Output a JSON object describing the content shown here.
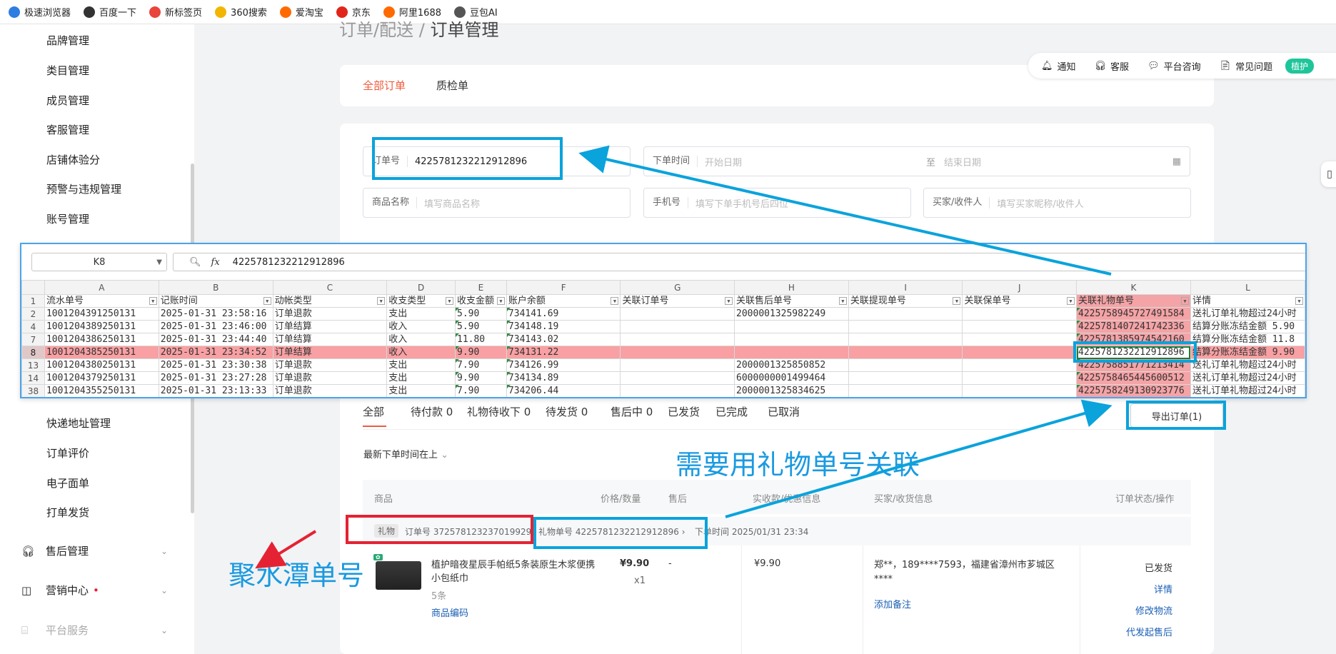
{
  "bookmarks": [
    {
      "label": "极速浏览器",
      "color": "#2f7de1"
    },
    {
      "label": "百度一下",
      "color": "#333333"
    },
    {
      "label": "新标签页",
      "color": "#e8453c"
    },
    {
      "label": "360搜索",
      "color": "#f2b600"
    },
    {
      "label": "爱淘宝",
      "color": "#ff6a00"
    },
    {
      "label": "京东",
      "color": "#e1251b"
    },
    {
      "label": "阿里1688",
      "color": "#ff6a00"
    },
    {
      "label": "豆包AI",
      "color": "#555555"
    }
  ],
  "sidebar": {
    "items": [
      "品牌管理",
      "类目管理",
      "成员管理",
      "客服管理",
      "店铺体验分",
      "预警与违规管理",
      "账号管理",
      "快递地址管理",
      "订单评价",
      "电子面单",
      "打单发货"
    ],
    "groups": [
      "售后管理",
      "营销中心",
      "平台服务"
    ]
  },
  "breadcrumb": {
    "parent": "订单/配送 /",
    "current": "订单管理"
  },
  "tabs": {
    "all": "全部订单",
    "inspect": "质检单"
  },
  "helpbar": {
    "notice": "通知",
    "service": "客服",
    "consult": "平台咨询",
    "faq": "常见问题",
    "pill": "植护"
  },
  "filters": {
    "order_no_label": "订单号",
    "order_no_value": "4225781232212912896",
    "time_label": "下单时间",
    "start_ph": "开始日期",
    "to": "至",
    "end_ph": "结束日期",
    "goods_label": "商品名称",
    "goods_ph": "填写商品名称",
    "phone_label": "手机号",
    "phone_ph": "填写下单手机号后四位",
    "buyer_label": "买家/收件人",
    "buyer_ph": "填写买家昵称/收件人"
  },
  "sheet": {
    "cell_ref": "K8",
    "formula": "4225781232212912896",
    "columns": [
      "A",
      "B",
      "C",
      "D",
      "E",
      "F",
      "G",
      "H",
      "I",
      "J",
      "K",
      "L"
    ],
    "headers": [
      "流水单号",
      "记账时间",
      "动帐类型",
      "收支类型",
      "收支金额",
      "账户余额",
      "关联订单号",
      "关联售后单号",
      "关联提现单号",
      "关联保单号",
      "关联礼物单号",
      "详情"
    ],
    "rows": [
      {
        "n": "2",
        "cells": [
          "1001204391250131",
          "2025-01-31 23:58:16",
          "订单退款",
          "支出",
          "5.90",
          "734141.69",
          "",
          "2000001325982249",
          "",
          "",
          "4225758945727491584",
          "送礼订单礼物超过24小时"
        ]
      },
      {
        "n": "4",
        "cells": [
          "1001204389250131",
          "2025-01-31 23:46:00",
          "订单结算",
          "收入",
          "5.90",
          "734148.19",
          "",
          "",
          "",
          "",
          "4225781407241742336",
          "结算分账冻结金额 5.90"
        ]
      },
      {
        "n": "7",
        "cells": [
          "1001204386250131",
          "2025-01-31 23:44:40",
          "订单结算",
          "收入",
          "11.80",
          "734143.02",
          "",
          "",
          "",
          "",
          "4225781385974542160",
          "结算分账冻结金额 11.8"
        ]
      },
      {
        "n": "8",
        "cells": [
          "1001204385250131",
          "2025-01-31 23:34:52",
          "订单结算",
          "收入",
          "9.90",
          "734131.22",
          "",
          "",
          "",
          "",
          "4225781232212912896",
          "结算分账冻结金额 9.90"
        ]
      },
      {
        "n": "13",
        "cells": [
          "1001204380250131",
          "2025-01-31 23:30:38",
          "订单退款",
          "支出",
          "7.90",
          "734126.99",
          "",
          "2000001325850852",
          "",
          "",
          "4225758851771213414",
          "送礼订单礼物超过24小时"
        ]
      },
      {
        "n": "14",
        "cells": [
          "1001204379250131",
          "2025-01-31 23:27:28",
          "订单退款",
          "支出",
          "9.90",
          "734134.89",
          "",
          "6000000001499464",
          "",
          "",
          "4225758465445600512",
          "送礼订单礼物超过24小时"
        ]
      },
      {
        "n": "38",
        "cells": [
          "1001204355250131",
          "2025-01-31 23:13:33",
          "订单退款",
          "支出",
          "7.90",
          "734206.44",
          "",
          "2000001325834625",
          "",
          "",
          "4225758249130923776",
          "送礼订单礼物超过24小时"
        ]
      }
    ]
  },
  "status_tabs": [
    "全部",
    "待付款 0",
    "礼物待收下 0",
    "待发货 0",
    "售后中 0",
    "已发货",
    "已完成",
    "已取消"
  ],
  "export_label": "导出订单(1)",
  "sort_label": "最新下单时间在上",
  "thead": [
    "商品",
    "价格/数量",
    "售后",
    "实收款/优惠信息",
    "买家/收货信息",
    "订单状态/操作"
  ],
  "order": {
    "gift_badge": "礼物",
    "order_no": "订单号 3725781232370199296",
    "gift_no": "礼物单号 4225781232212912896",
    "time": "下单时间 2025/01/31 23:34",
    "title": "植护暗夜星辰手帕纸5条装原生木浆便携小包纸巾",
    "spec": "5条",
    "code_link": "商品编码",
    "price": "¥9.90",
    "qty": "x1",
    "after": "-",
    "paid": "¥9.90",
    "buyer": "郑**，189****7593，福建省漳州市芗城区****",
    "note": "添加备注",
    "status": "已发货",
    "ops": [
      "详情",
      "修改物流",
      "代发起售后"
    ]
  },
  "annotations": {
    "need": "需要用礼物单号关联",
    "jst": "聚水潭单号"
  }
}
